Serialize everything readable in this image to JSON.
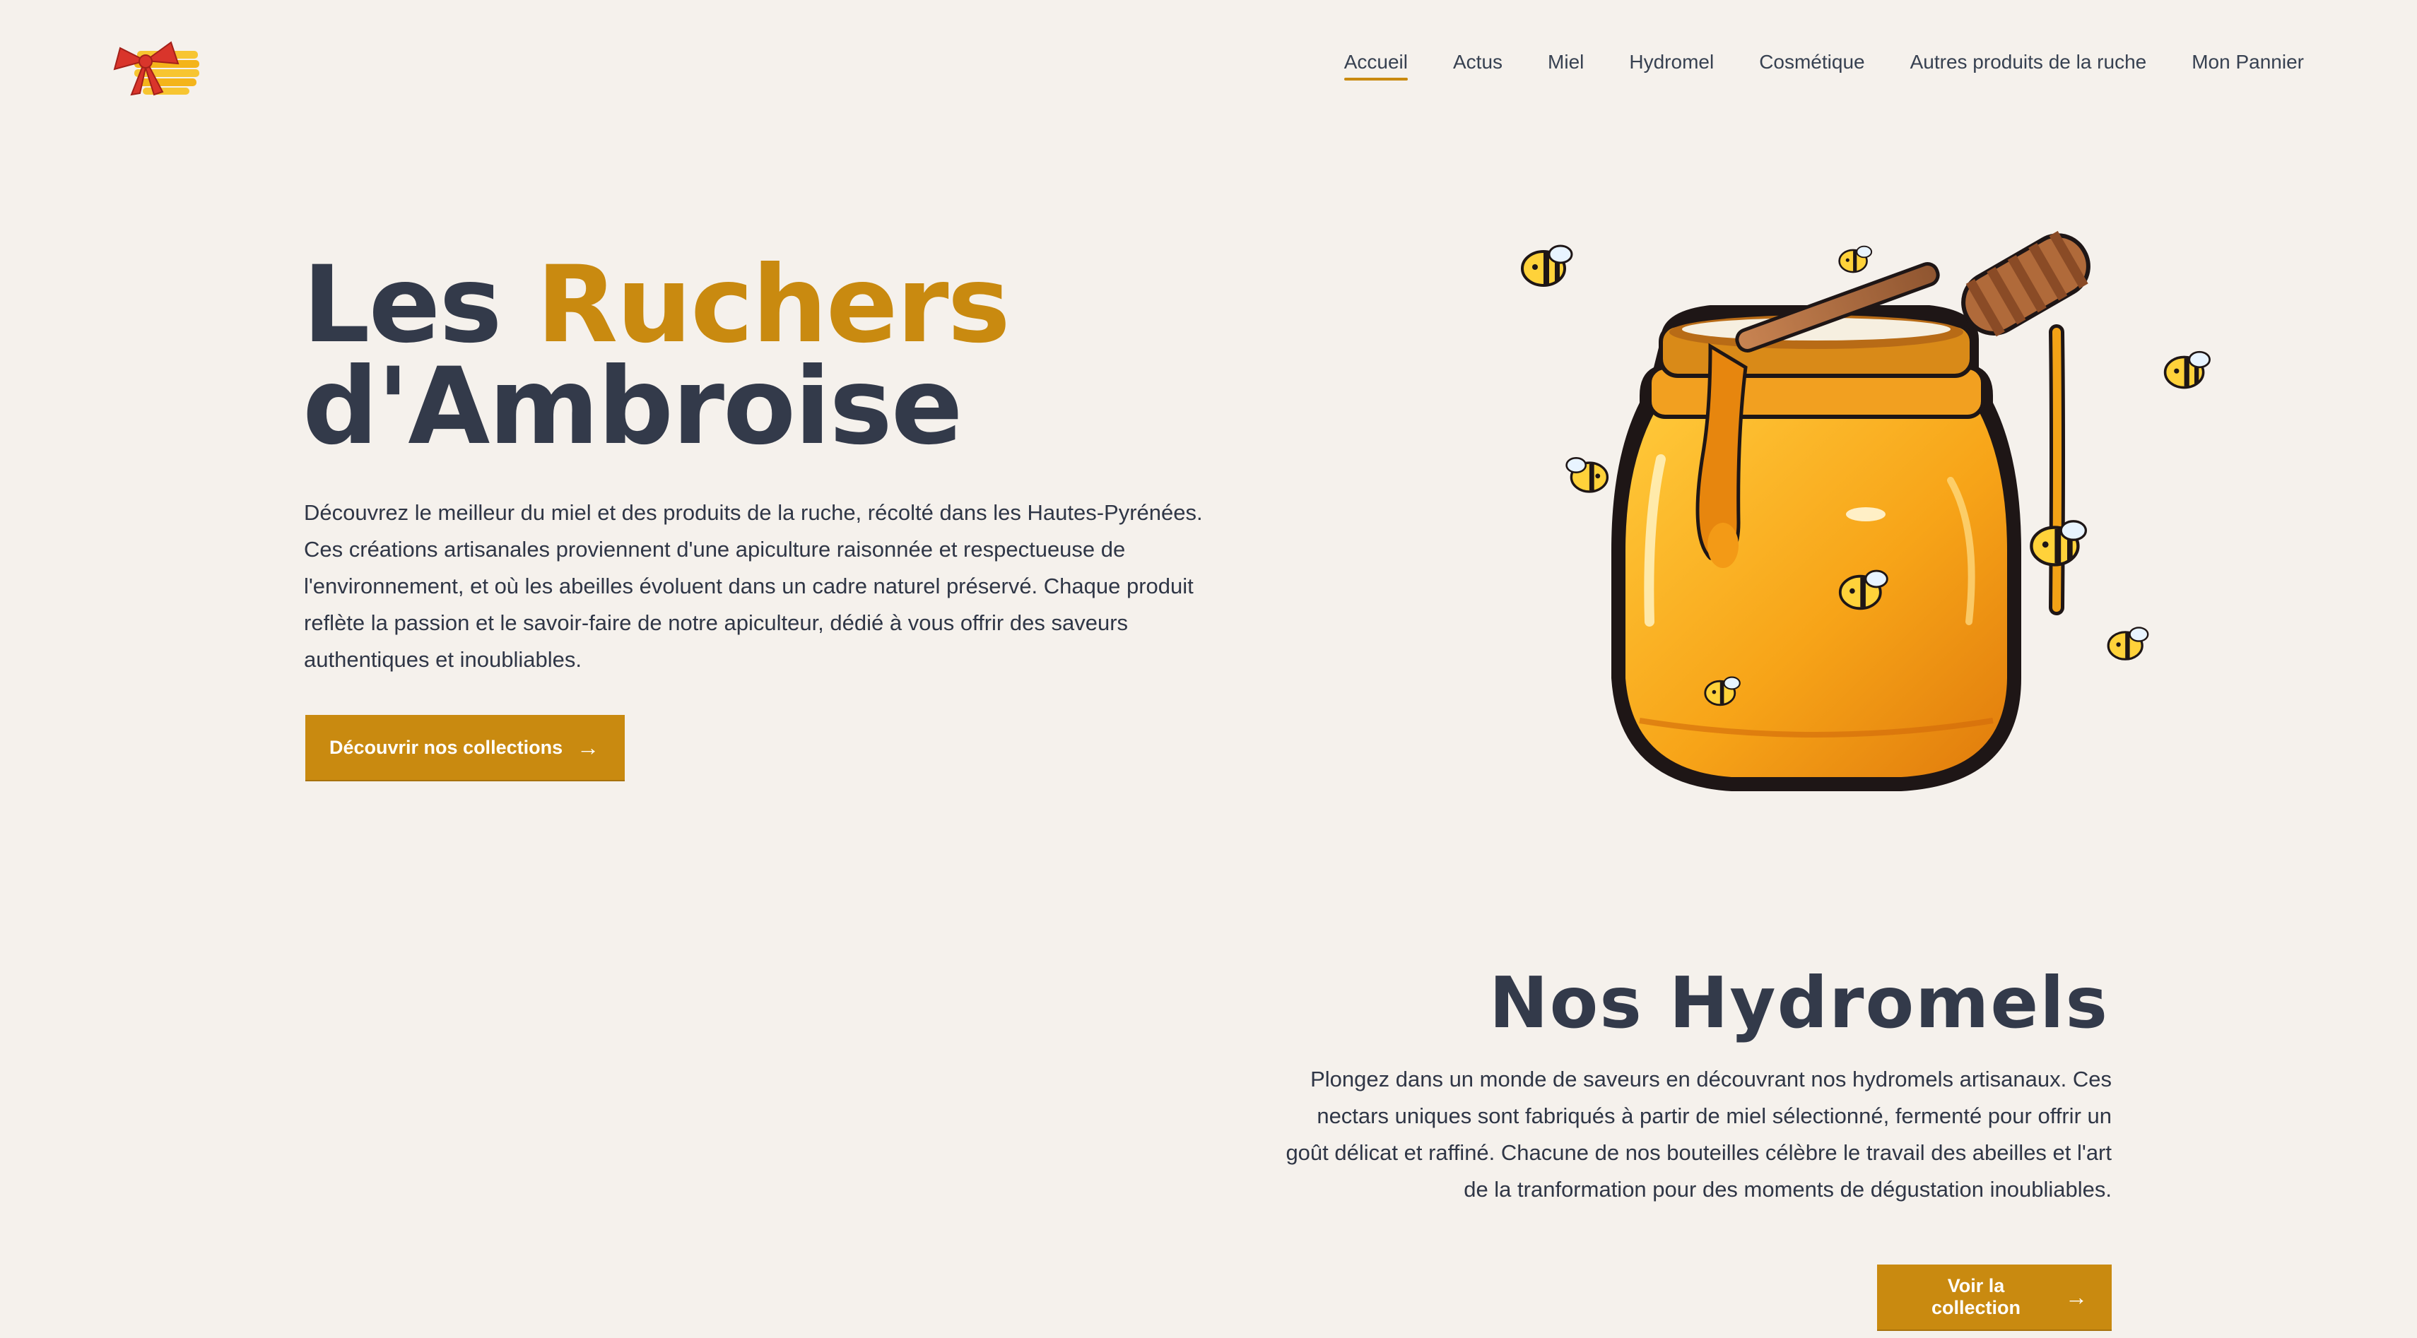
{
  "header": {
    "logo_icon": "beehive-bow-icon",
    "nav": [
      {
        "label": "Accueil",
        "active": true
      },
      {
        "label": "Actus",
        "active": false
      },
      {
        "label": "Miel",
        "active": false
      },
      {
        "label": "Hydromel",
        "active": false
      },
      {
        "label": "Cosmétique",
        "active": false
      },
      {
        "label": "Autres produits de la ruche",
        "active": false
      },
      {
        "label": "Mon Pannier",
        "active": false
      }
    ]
  },
  "hero": {
    "title_part1": "Les ",
    "title_accent": "Ruchers",
    "title_part2": "d'Ambroise",
    "description": "Découvrez le meilleur du miel et des produits de la ruche, récolté dans les Hautes-Pyrénées. Ces créations artisanales proviennent d'une apiculture raisonnée et respectueuse de l'environnement, et où les abeilles évoluent dans un cadre naturel préservé. Chaque produit reflète la passion et le savoir-faire de notre apiculteur, dédié à vous offrir des saveurs authentiques et inoubliables.",
    "cta_label": "Découvrir nos collections",
    "cta_icon": "arrow-right-icon",
    "illustration": "honey-jar-with-bees"
  },
  "section_hydromels": {
    "title": "Nos Hydromels",
    "description": "Plongez dans un monde de saveurs en découvrant nos hydromels artisanaux. Ces nectars uniques sont fabriqués à partir de miel sélectionné, fermenté pour offrir un goût délicat et raffiné. Chacune de nos bouteilles célèbre le travail des abeilles et l'art de la tranformation pour des moments de dégustation inoubliables.",
    "cta_label": "Voir la collection",
    "cta_icon": "arrow-right-icon"
  },
  "colors": {
    "background": "#f5f1ec",
    "accent": "#c98a10",
    "heading": "#333a4a",
    "text": "#2f3646"
  }
}
